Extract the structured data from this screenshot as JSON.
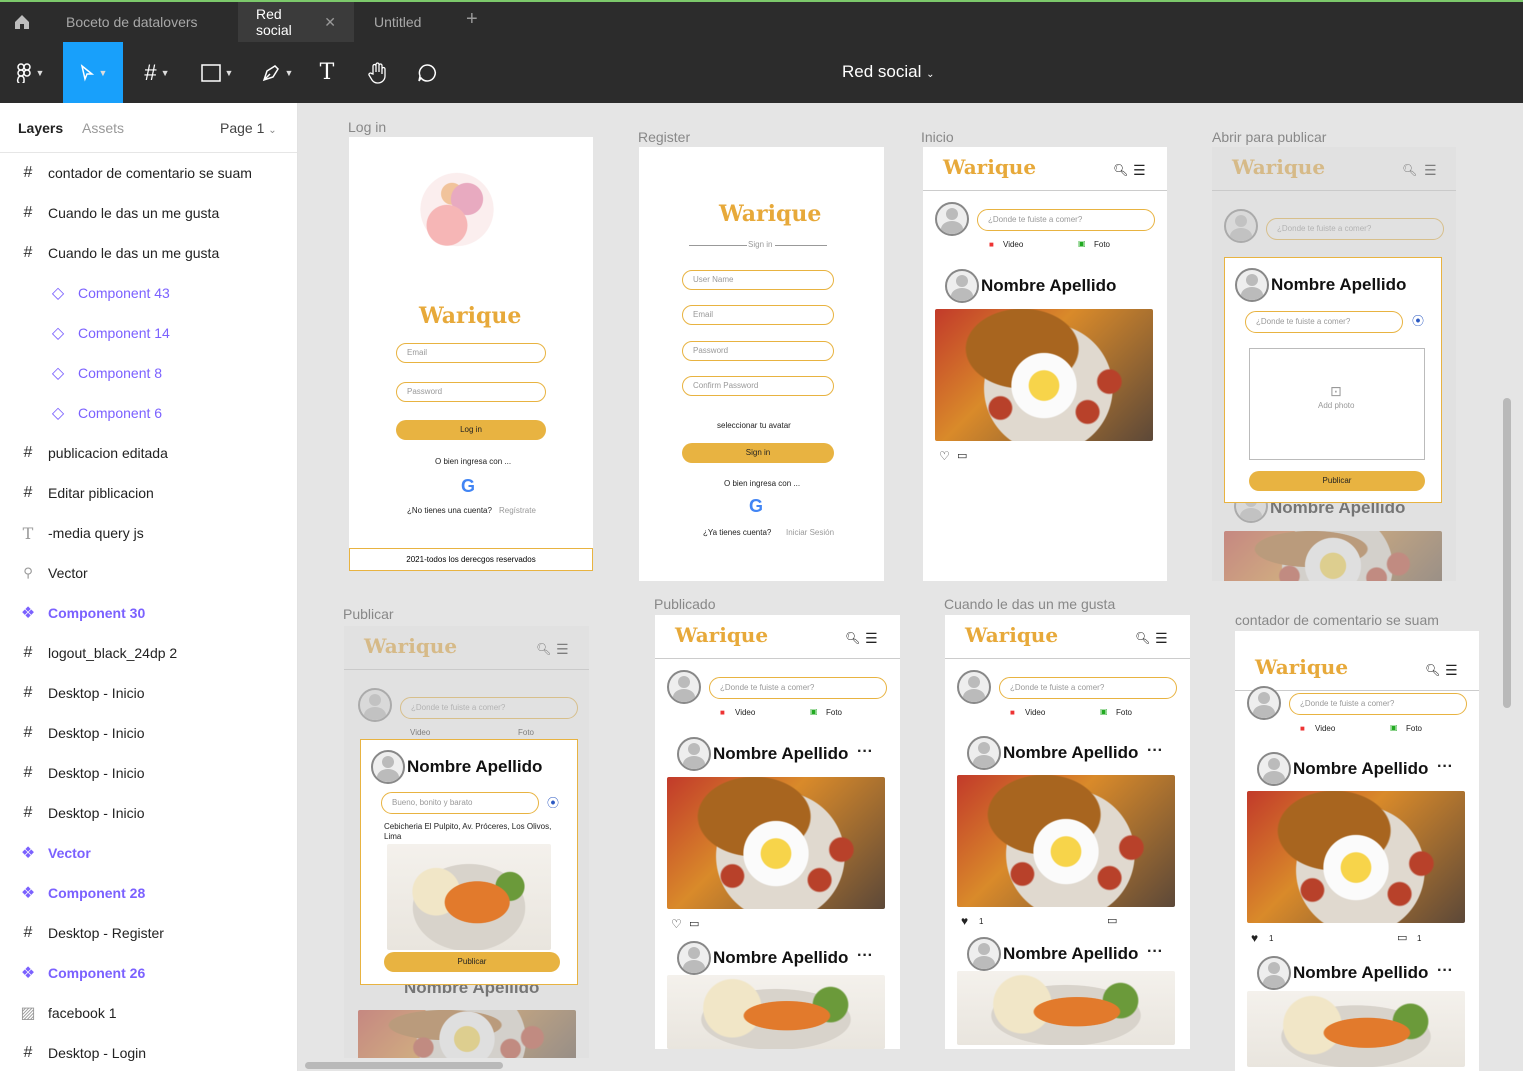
{
  "tabs": [
    {
      "label": "Boceto de datalovers"
    },
    {
      "label": "Red social"
    },
    {
      "label": "Untitled"
    }
  ],
  "document_title": "Red social",
  "panel": {
    "layers_tab": "Layers",
    "assets_tab": "Assets",
    "page": "Page 1"
  },
  "layers": [
    {
      "label": "contador de comentario se suam",
      "icon": "frame"
    },
    {
      "label": "Cuando le das un me gusta",
      "icon": "frame"
    },
    {
      "label": "Cuando le das un me gusta",
      "icon": "frame"
    },
    {
      "label": "Component 43",
      "icon": "instance"
    },
    {
      "label": "Component 14",
      "icon": "instance"
    },
    {
      "label": "Component 8",
      "icon": "instance"
    },
    {
      "label": "Component 6",
      "icon": "instance"
    },
    {
      "label": "publicacion editada",
      "icon": "frame"
    },
    {
      "label": "Editar piblicacion",
      "icon": "frame"
    },
    {
      "label": "-media query js",
      "icon": "text"
    },
    {
      "label": "Vector",
      "icon": "vector"
    },
    {
      "label": "Component 30",
      "icon": "component"
    },
    {
      "label": "logout_black_24dp 2",
      "icon": "frame"
    },
    {
      "label": "Desktop - Inicio",
      "icon": "frame"
    },
    {
      "label": "Desktop - Inicio",
      "icon": "frame"
    },
    {
      "label": "Desktop - Inicio",
      "icon": "frame"
    },
    {
      "label": "Desktop - Inicio",
      "icon": "frame"
    },
    {
      "label": "Vector",
      "icon": "component"
    },
    {
      "label": "Component 28",
      "icon": "component"
    },
    {
      "label": "Desktop - Register",
      "icon": "frame"
    },
    {
      "label": "Component 26",
      "icon": "component"
    },
    {
      "label": "facebook 1",
      "icon": "image"
    },
    {
      "label": "Desktop - Login",
      "icon": "frame"
    }
  ],
  "frames": {
    "login": {
      "label": "Log in",
      "logo": "Warique",
      "email": "Email",
      "password": "Password",
      "button": "Log in",
      "alt": "O bien ingresa con ...",
      "no_account": "¿No tienes una cuenta?",
      "register": "Regístrate",
      "footer": "2021-todos los derecgos reservados"
    },
    "register": {
      "label": "Register",
      "logo": "Warique",
      "sign_in": "Sign in",
      "username": "User Name",
      "email": "Email",
      "password": "Password",
      "confirm": "Confirm Password",
      "avatar": "seleccionar tu avatar",
      "button": "Sign in",
      "alt": "O bien ingresa con ...",
      "have_account": "¿Ya tienes cuenta?",
      "login": "Iniciar Sesión"
    },
    "inicio": {
      "label": "Inicio"
    },
    "abrir": {
      "label": "Abrir para publicar",
      "add_photo": "Add photo",
      "publish": "Publicar"
    },
    "publicar": {
      "label": "Publicar",
      "input": "Bueno, bonito y barato",
      "address": "Cebicheria El Pulpito, Av. Próceres, Los Olivos, Lima",
      "publish": "Publicar"
    },
    "publicado": {
      "label": "Publicado"
    },
    "like": {
      "label": "Cuando le das un me gusta",
      "likes": "1"
    },
    "comment": {
      "label": "contador de comentario se suam",
      "likes": "1",
      "comments": "1"
    }
  },
  "common": {
    "logo": "Warique",
    "prompt": "¿Donde te fuiste a comer?",
    "video": "Video",
    "foto": "Foto",
    "user": "Nombre Apellido",
    "more": "···"
  }
}
